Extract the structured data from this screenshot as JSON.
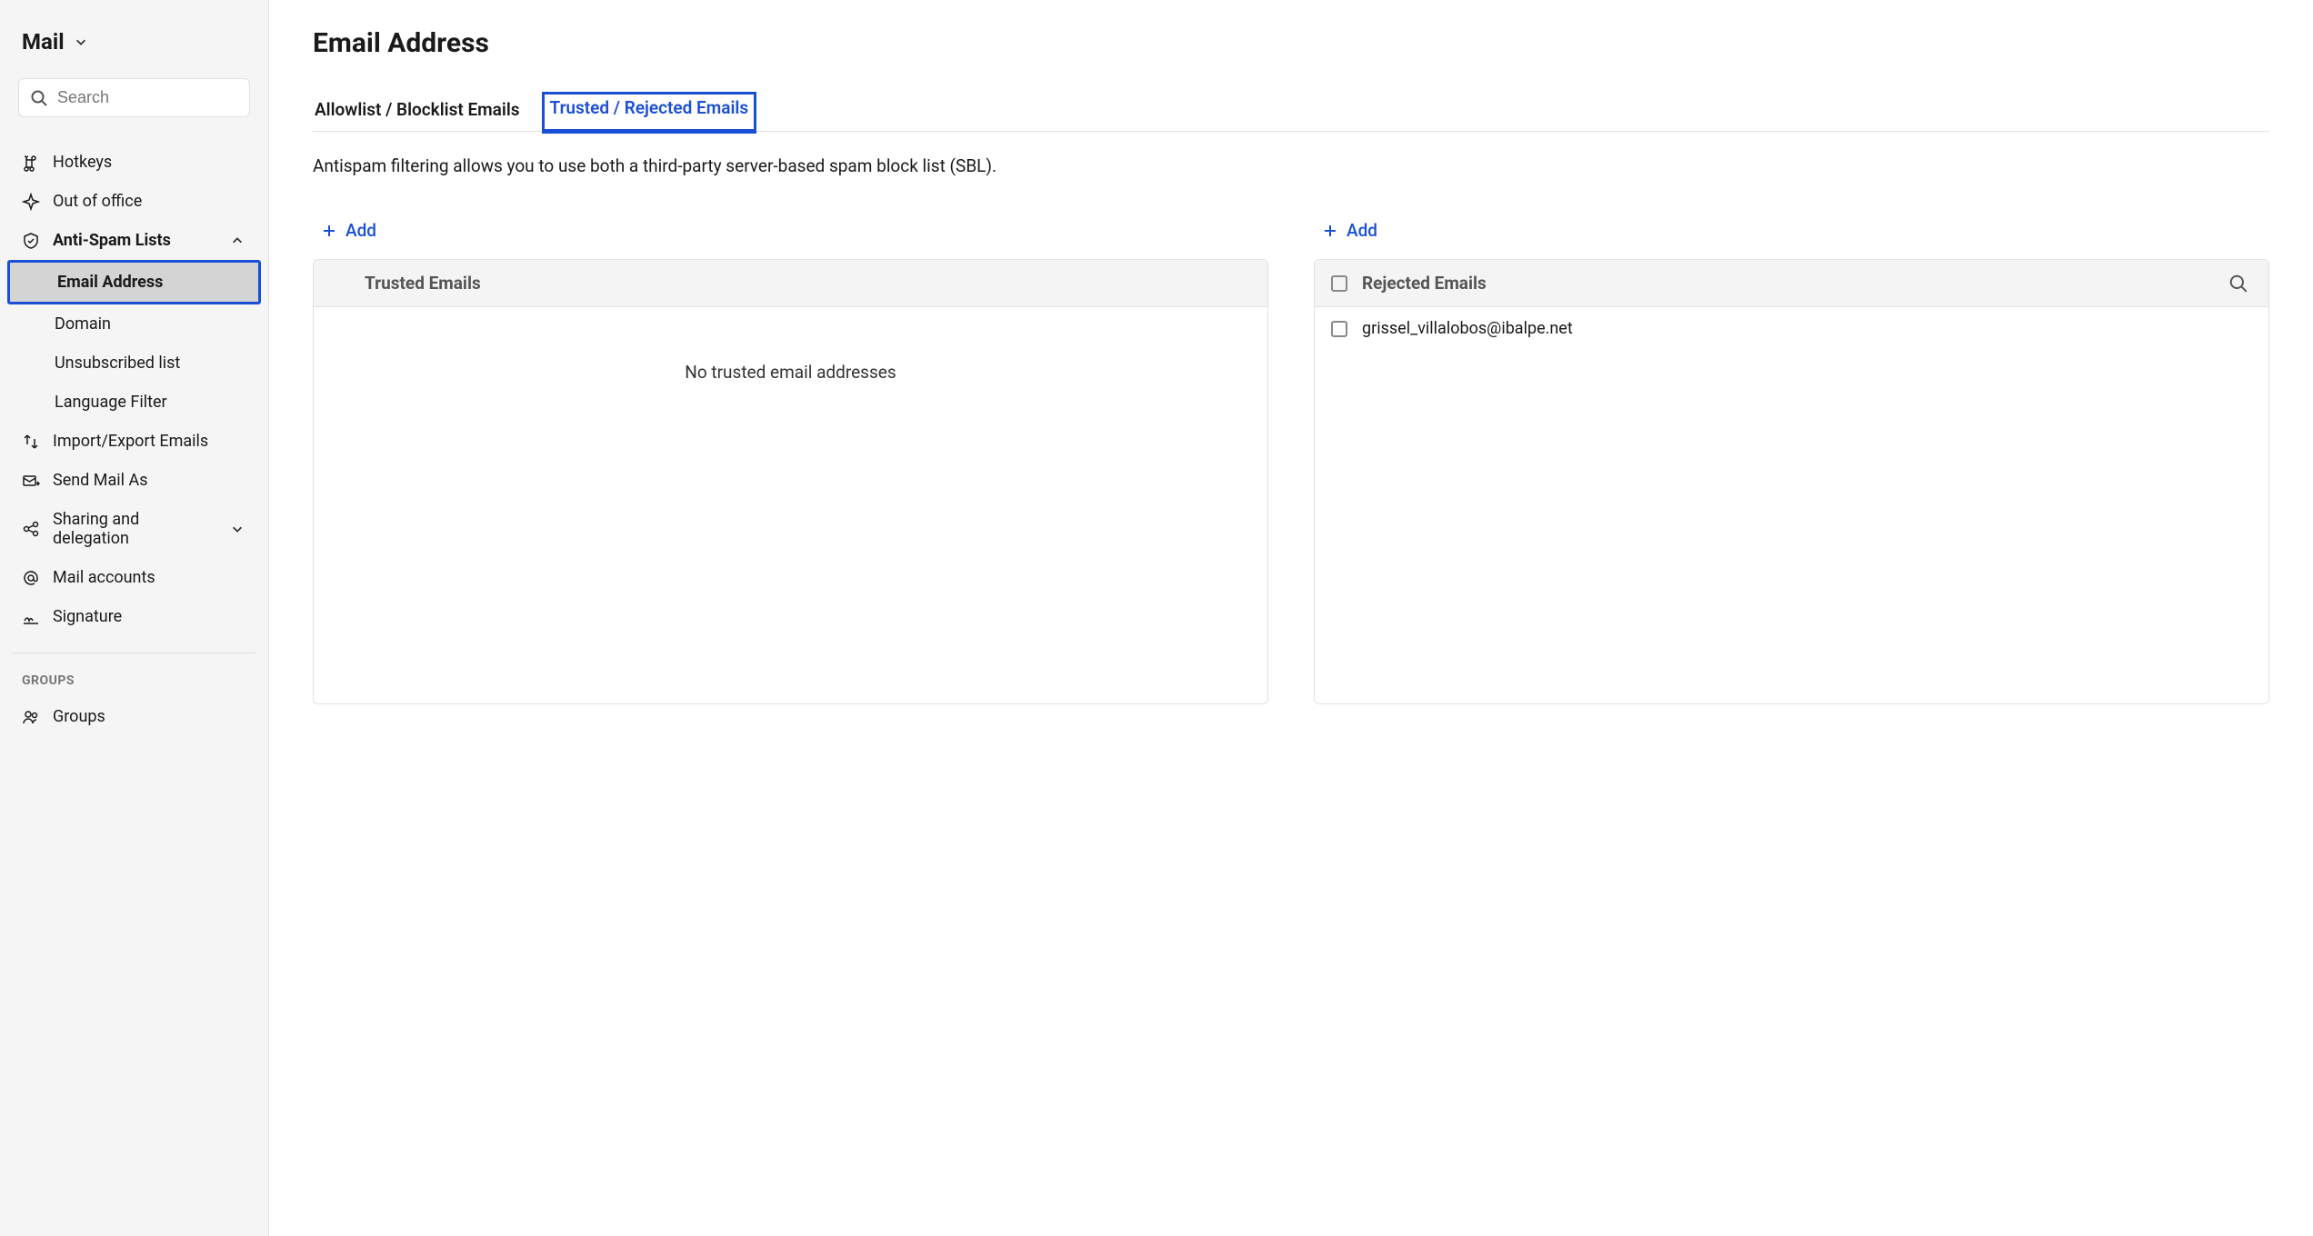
{
  "sidebar": {
    "header_title": "Mail",
    "search_placeholder": "Search",
    "items": [
      {
        "label": "Hotkeys",
        "icon": "command-icon"
      },
      {
        "label": "Out of office",
        "icon": "airplane-icon"
      },
      {
        "label": "Anti-Spam Lists",
        "icon": "shield-icon",
        "expanded": true,
        "children": [
          {
            "label": "Email Address",
            "active": true
          },
          {
            "label": "Domain"
          },
          {
            "label": "Unsubscribed list"
          },
          {
            "label": "Language Filter"
          }
        ]
      },
      {
        "label": "Import/Export Emails",
        "icon": "import-export-icon"
      },
      {
        "label": "Send Mail As",
        "icon": "send-as-icon"
      },
      {
        "label": "Sharing and delegation",
        "icon": "share-icon",
        "expandable": true
      },
      {
        "label": "Mail accounts",
        "icon": "at-icon"
      },
      {
        "label": "Signature",
        "icon": "signature-icon"
      }
    ],
    "section_heading": "GROUPS",
    "groups_item": {
      "label": "Groups",
      "icon": "people-icon"
    }
  },
  "main": {
    "page_title": "Email Address",
    "tabs": [
      {
        "label": "Allowlist / Blocklist Emails"
      },
      {
        "label": "Trusted / Rejected Emails",
        "active": true
      }
    ],
    "description": "Antispam filtering allows you to use both a third-party server-based spam block list (SBL).",
    "add_label": "Add",
    "trusted": {
      "title": "Trusted Emails",
      "empty": "No trusted email addresses"
    },
    "rejected": {
      "title": "Rejected Emails",
      "rows": [
        "grissel_villalobos@ibalpe.net"
      ]
    }
  }
}
